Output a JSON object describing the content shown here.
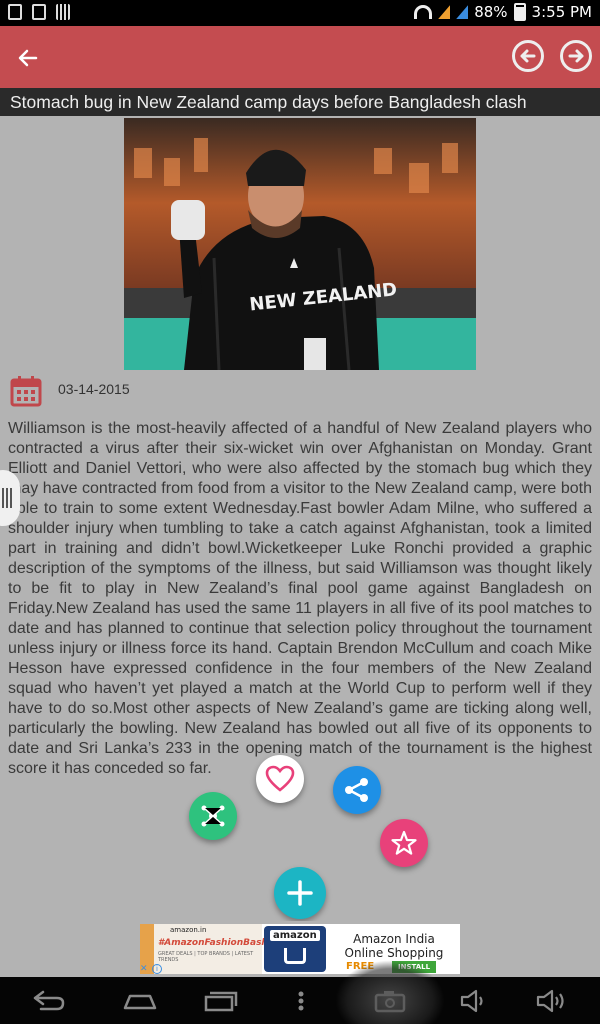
{
  "status_bar": {
    "battery": "88%",
    "time": "3:55 PM"
  },
  "toolbar": {
    "back_icon": "arrow-left-icon",
    "prev_icon": "circle-arrow-left-icon",
    "next_icon": "circle-arrow-right-icon"
  },
  "article": {
    "headline": "Stomach bug in New Zealand camp days before Bangladesh clash",
    "date": "03-14-2015",
    "body": "Williamson is the most-heavily affected of a handful of New Zealand players who contracted a virus after their six-wicket win over Afghanistan on Monday. Grant Elliott and Daniel Vettori, who were also affected by the stomach bug which they may have contracted from food from a visitor to the New Zealand camp, were both able to train to some extent Wednesday.Fast bowler Adam Milne, who suffered a shoulder injury when tumbling to take a catch against Afghanistan, took a limited part in training and didn’t bowl.Wicketkeeper Luke Ronchi provided a graphic description of the symptoms of the illness, but said Williamson was thought likely to be fit to play in New Zealand’s final pool game against Bangladesh on Friday.New Zealand has used the same 11 players in all five of its pool matches to date and has planned to continue that selection policy throughout the tournament unless injury or illness force its hand. Captain Brendon McCullum and coach Mike Hesson have expressed confidence in the four members of the New Zealand squad who haven’t yet played a match at the World Cup to perform well if they have to do so.Most other aspects of New Zealand’s game are ticking along well, particularly the bowling. New Zealand has bowled out all five of its opponents to date and Sri Lanka’s 233 in the opening match of the tournament is the highest score it has conceded so far.",
    "photo_jersey_text": "NEW ZEALAND"
  },
  "fabs": {
    "like_icon": "heart-icon",
    "share_icon": "share-icon",
    "network_icon": "network-icon",
    "star_icon": "star-icon",
    "add_icon": "plus-icon"
  },
  "ad": {
    "left_logo": "amazon.in",
    "left_title": "#AmazonFashionBash",
    "left_sub": "GREAT DEALS | TOP BRANDS | LATEST TRENDS",
    "app_brand": "amazon",
    "app_name": "Amazon India Online Shopping",
    "price": "FREE",
    "install": "INSTALL",
    "close": "✕"
  },
  "colors": {
    "toolbar": "#c44c50",
    "share": "#1e90e6",
    "network": "#2ec27e",
    "star": "#e8417a",
    "add": "#1cb5c4",
    "calendar": "#c0474b"
  }
}
